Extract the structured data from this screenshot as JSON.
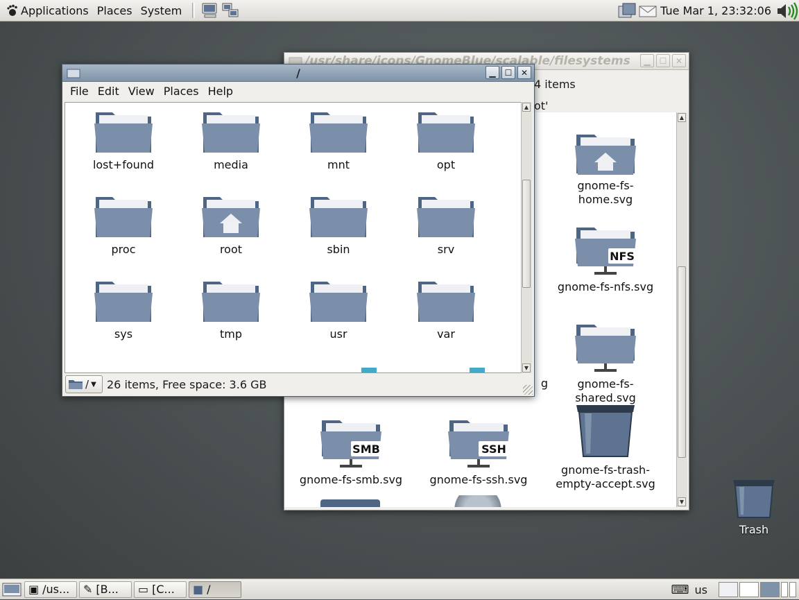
{
  "top_panel": {
    "menus": [
      "Applications",
      "Places",
      "System"
    ],
    "clock": "Tue Mar  1, 23:32:06"
  },
  "back_window": {
    "title": "/usr/share/icons/GnomeBlue/scalable/filesystems",
    "info_partial": "4 items",
    "path_partial": "ot'",
    "items": [
      {
        "label": "g",
        "badge": ""
      },
      {
        "label": "gnome-fs-home.svg",
        "badge": "home"
      },
      {
        "label": "gnome-fs-nfs.svg",
        "badge": "NFS"
      },
      {
        "label": "gnome-fs-shared.svg",
        "badge": "shared"
      },
      {
        "label": "gnome-fs-smb.svg",
        "badge": "SMB"
      },
      {
        "label": "gnome-fs-ssh.svg",
        "badge": "SSH"
      },
      {
        "label": "gnome-fs-trash-empty-accept.svg",
        "label_line1": "gnome-fs-trash-",
        "label_line2": "empty-accept.svg",
        "badge": "trash"
      }
    ]
  },
  "front_window": {
    "title": "/",
    "menu": [
      "File",
      "Edit",
      "View",
      "Places",
      "Help"
    ],
    "folders": [
      "lost+found",
      "media",
      "mnt",
      "opt",
      "proc",
      "root",
      "sbin",
      "srv",
      "sys",
      "tmp",
      "usr",
      "var"
    ],
    "status": "26 items, Free space: 3.6 GB",
    "location_combo": "/"
  },
  "desktop": {
    "trash_label": "Trash"
  },
  "taskbar": {
    "tasks": [
      "/us...",
      "[B...",
      "[C...",
      "/"
    ],
    "keyboard_layout": "us"
  },
  "colors": {
    "folder": "#7b8faa",
    "folder_dark": "#4f6584",
    "titlebar_active": "#8ea2b7",
    "desktop": "#4f5556"
  }
}
